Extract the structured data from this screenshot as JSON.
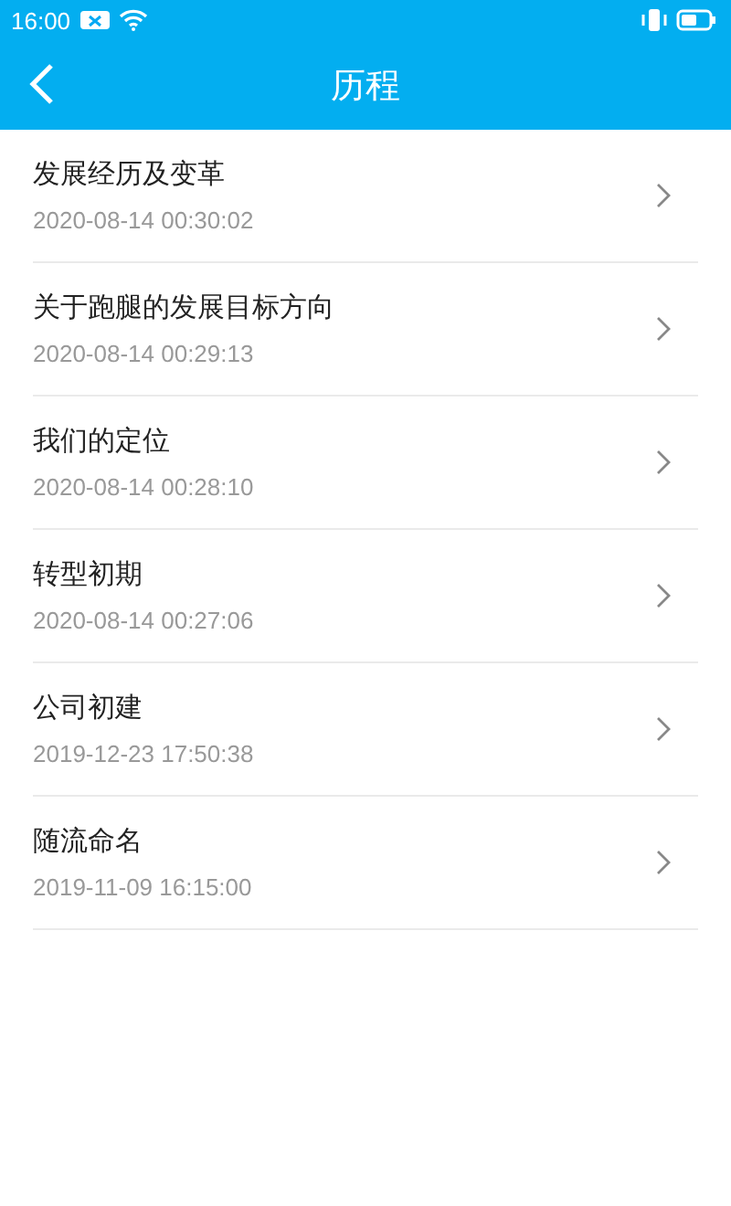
{
  "status_bar": {
    "time": "16:00"
  },
  "header": {
    "title": "历程"
  },
  "items": [
    {
      "title": "发展经历及变革",
      "time": "2020-08-14 00:30:02"
    },
    {
      "title": "关于跑腿的发展目标方向",
      "time": "2020-08-14 00:29:13"
    },
    {
      "title": "我们的定位",
      "time": "2020-08-14 00:28:10"
    },
    {
      "title": "转型初期",
      "time": "2020-08-14 00:27:06"
    },
    {
      "title": "公司初建",
      "time": "2019-12-23 17:50:38"
    },
    {
      "title": "随流命名",
      "time": "2019-11-09 16:15:00"
    }
  ]
}
